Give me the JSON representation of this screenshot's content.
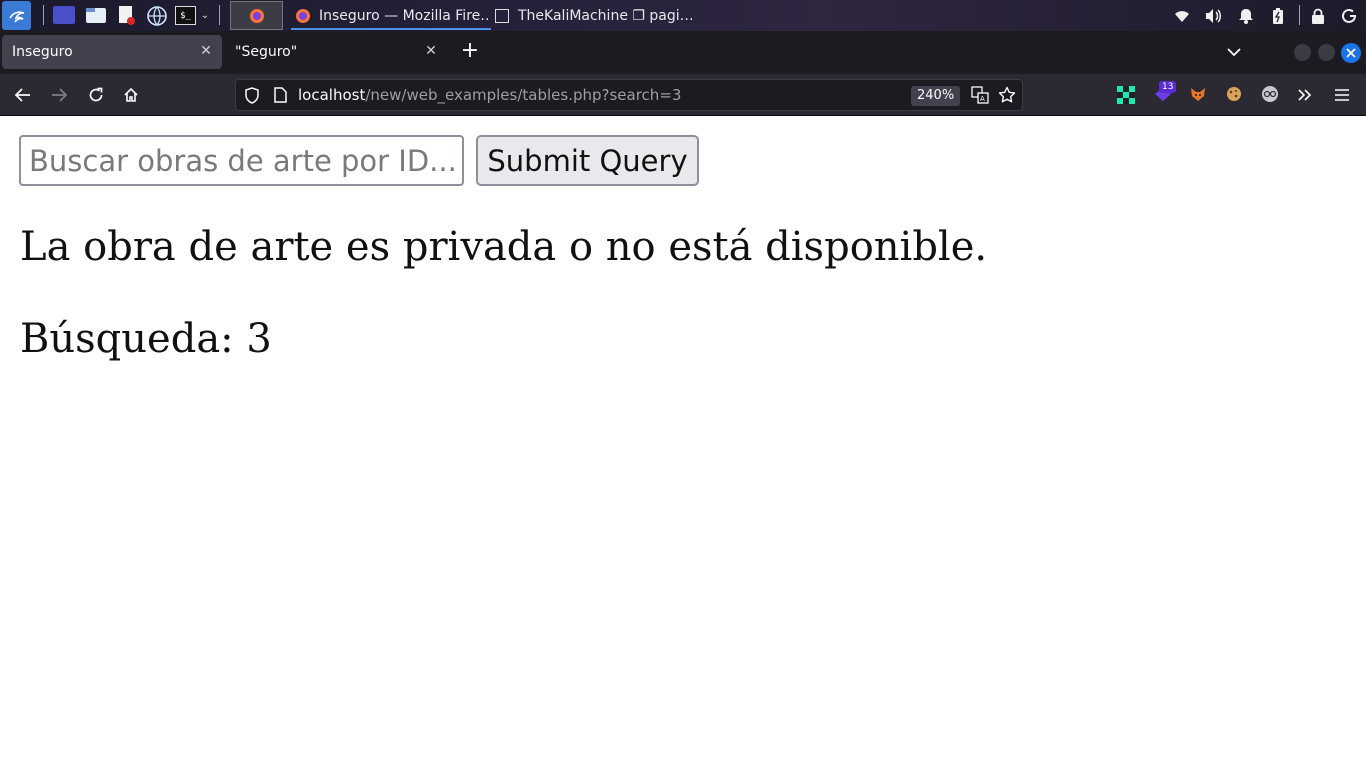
{
  "taskbar": {
    "tasks": [
      {
        "label": "Inseguro — Mozilla Fire…",
        "icon": "firefox-icon",
        "active": true
      },
      {
        "label": "TheKaliMachine ❐ pagi…",
        "icon": "terminal-icon",
        "active": false
      }
    ],
    "tray_icons": [
      "wifi-icon",
      "volume-icon",
      "notification-bell-icon",
      "battery-icon",
      "lock-icon",
      "power-icon"
    ]
  },
  "browser": {
    "tabs": [
      {
        "title": "Inseguro",
        "active": true
      },
      {
        "title": "\"Seguro\"",
        "active": false
      }
    ],
    "new_tab_label": "+",
    "url": {
      "host": "localhost",
      "path": "/new/web_examples/tables.php?search=3"
    },
    "zoom": "240%",
    "extension_badge": "13"
  },
  "page": {
    "search_placeholder": "Buscar obras de arte por ID...",
    "submit_label": "Submit Query",
    "message": "La obra de arte es privada o no está disponible.",
    "search_echo": "Búsqueda: 3"
  },
  "colors": {
    "accent": "#0060df",
    "close_button": "#1a73e8",
    "toolbar_bg": "#2b2a33",
    "tabstrip_bg": "#1c1b22"
  }
}
